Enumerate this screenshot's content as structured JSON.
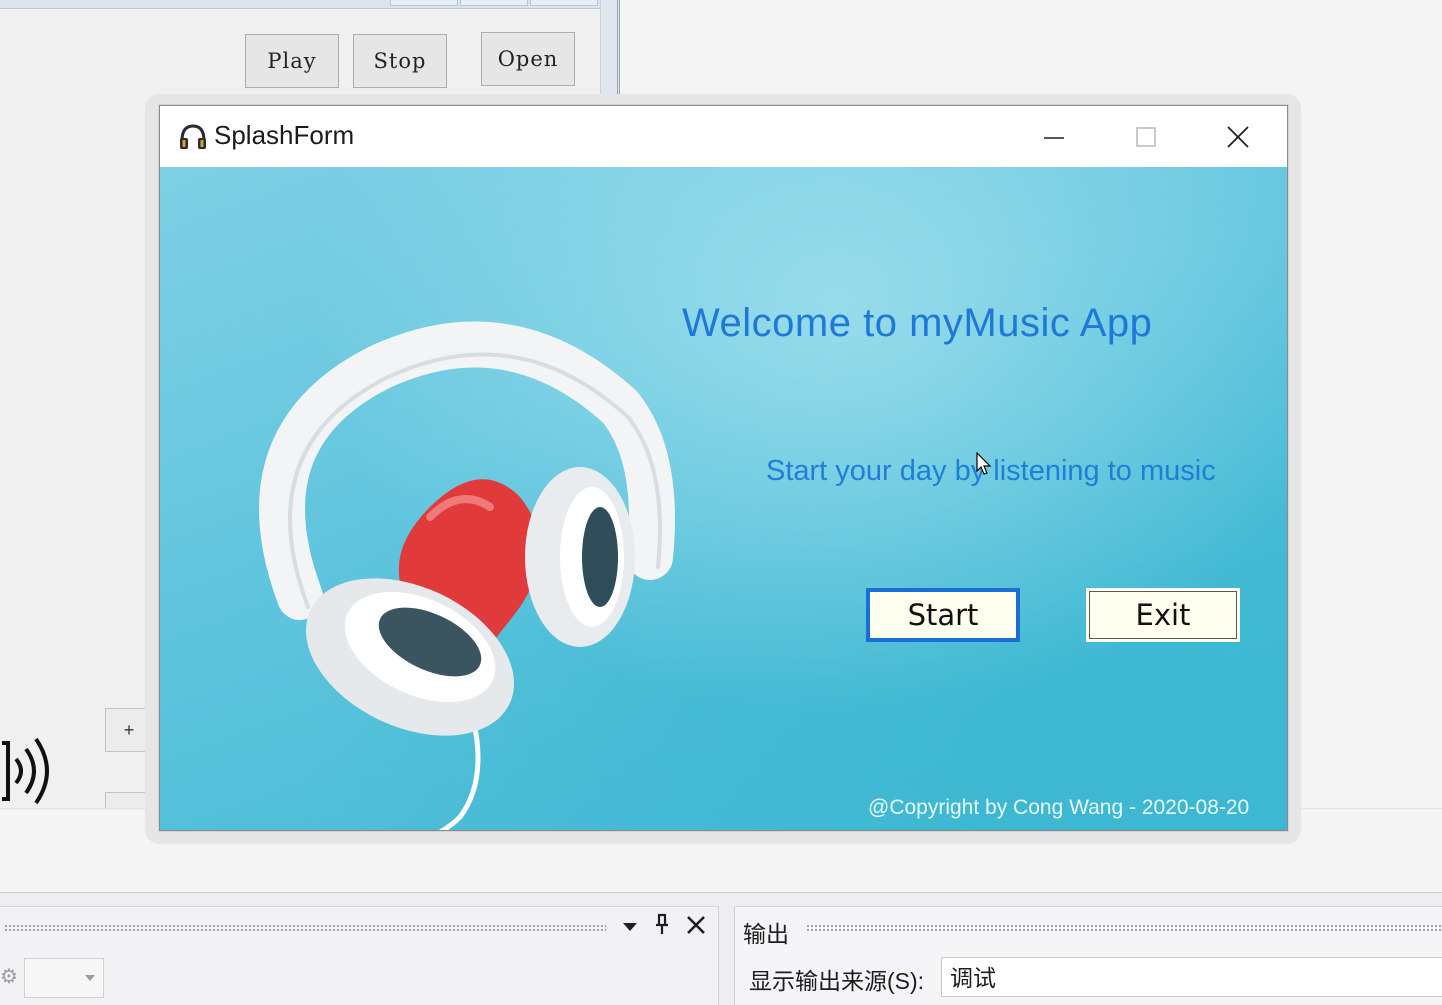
{
  "designer": {
    "buttons": {
      "play": "Play",
      "stop": "Stop",
      "open": "Open"
    },
    "plus_label": "+"
  },
  "splash_window": {
    "title": "SplashForm",
    "icon": "headphones-icon",
    "controls": {
      "minimize": "minimize-icon",
      "maximize": "maximize-icon",
      "close": "close-icon"
    },
    "welcome_text": "Welcome to myMusic App",
    "tagline": "Start your day by listening to music",
    "start_label": "Start",
    "exit_label": "Exit",
    "copyright": "@Copyright by Cong Wang - 2020-08-20",
    "colors": {
      "text_accent": "#1e78d8",
      "button_bg": "#fffff0",
      "start_border": "#1a6fd6"
    }
  },
  "output_panel": {
    "title": "输出",
    "source_label": "显示输出来源(S):",
    "source_value": "调试"
  }
}
